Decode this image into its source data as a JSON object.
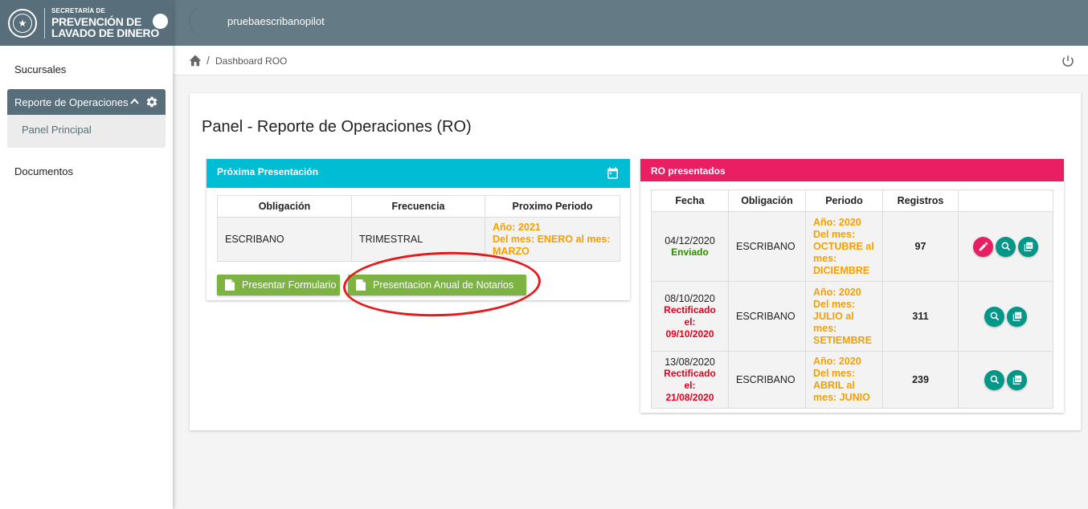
{
  "brand": {
    "line1": "SECRETARÍA DE",
    "line2": "PREVENCIÓN DE",
    "line3": "LAVADO DE DINERO"
  },
  "header": {
    "username": "pruebaescribanopilot"
  },
  "sidebar": {
    "items": [
      {
        "label": "Sucursales"
      },
      {
        "label": "Reporte de Operaciones",
        "expanded": true,
        "sub_items": [
          {
            "label": "Panel Principal"
          }
        ]
      },
      {
        "label": "Documentos"
      }
    ]
  },
  "breadcrumb": {
    "sep": "/",
    "current": "Dashboard ROO"
  },
  "page": {
    "title": "Panel - Reporte de Operaciones (RO)"
  },
  "next_panel": {
    "title": "Próxima Presentación",
    "columns": [
      "Obligación",
      "Frecuencia",
      "Proximo Periodo"
    ],
    "row": {
      "obligacion": "ESCRIBANO",
      "frecuencia": "TRIMESTRAL",
      "periodo_line1": "Año: 2021",
      "periodo_line2": "Del mes: ENERO al mes: MARZO"
    },
    "btn_formulario": "Presentar Formulario",
    "btn_anual": "Presentacion Anual de Notarios"
  },
  "ro_panel": {
    "title": "RO presentados",
    "columns": [
      "Fecha",
      "Obligación",
      "Periodo",
      "Registros",
      ""
    ],
    "rows": [
      {
        "fecha": "04/12/2020",
        "status": "Enviado",
        "status_type": "sent",
        "obligacion": "ESCRIBANO",
        "periodo_year": "Año: 2020",
        "periodo": "Del mes: OCTUBRE al mes: DICIEMBRE",
        "registros": "97"
      },
      {
        "fecha": "08/10/2020",
        "status": "Rectificado el: 09/10/2020",
        "status_type": "rect",
        "obligacion": "ESCRIBANO",
        "periodo_year": "Año: 2020",
        "periodo": "Del mes: JULIO al mes: SETIEMBRE",
        "registros": "311"
      },
      {
        "fecha": "13/08/2020",
        "status": "Rectificado el: 21/08/2020",
        "status_type": "rect",
        "obligacion": "ESCRIBANO",
        "periodo_year": "Año: 2020",
        "periodo": "Del mes: ABRIL al mes: JUNIO",
        "registros": "239"
      }
    ]
  },
  "colors": {
    "sidebar_head": "#586e7b",
    "cyan": "#00bcd4",
    "pink": "#e91e63",
    "green_btn": "#7cb342",
    "teal": "#009688",
    "orange": "#f5a000",
    "red": "#e3001b",
    "annotation": "#e31b1b"
  }
}
